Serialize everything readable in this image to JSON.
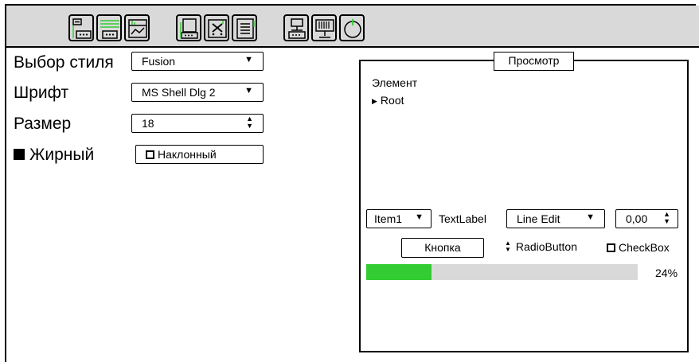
{
  "toolbar": {
    "buttons": [
      {
        "name": "bottom-left-panel-icon"
      },
      {
        "name": "bottom-right-panel-icon"
      },
      {
        "name": "chart-window-icon"
      },
      {
        "name": "panel-window-icon"
      },
      {
        "name": "close-window-icon"
      },
      {
        "name": "text-document-icon"
      },
      {
        "name": "network-node-icon"
      },
      {
        "name": "display-stand-icon"
      },
      {
        "name": "power-icon"
      }
    ],
    "accent_color": "#33cc33"
  },
  "settings": {
    "style_label": "Выбор стиля",
    "style_value": "Fusion",
    "font_label": "Шрифт",
    "font_value": "MS Shell Dlg 2",
    "size_label": "Размер",
    "size_value": "18",
    "bold_label": "Жирный",
    "bold_checked": true,
    "italic_label": "Наклонный",
    "italic_checked": false
  },
  "preview": {
    "title": "Просмотр",
    "tree_header": "Элемент",
    "tree_root": "Root",
    "combo_value": "Item1",
    "text_label": "TextLabel",
    "line_edit_value": "Line Edit",
    "spin_value": "0,00",
    "button_label": "Кнопка",
    "radio_label": "RadioButton",
    "checkbox_label": "CheckBox",
    "progress_value": 0.24,
    "progress_text": "24%",
    "progress_color": "#33cc33"
  }
}
